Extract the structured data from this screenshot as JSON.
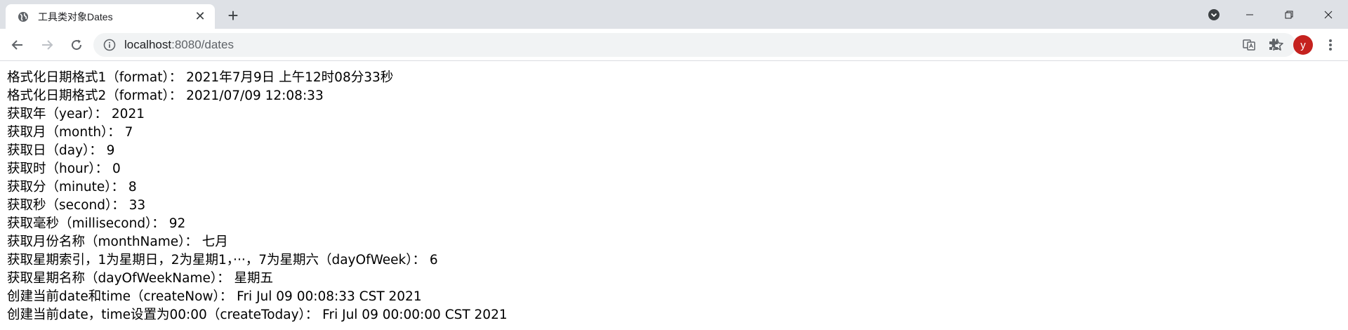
{
  "browser": {
    "tab_title": "工具类对象Dates",
    "tab_close": "✕",
    "new_tab": "+",
    "url_host": "localhost",
    "url_rest": ":8080/dates",
    "profile_initial": "y"
  },
  "content": {
    "lines": [
      "格式化日期格式1（format）：  2021年7月9日 上午12时08分33秒",
      "格式化日期格式2（format）：  2021/07/09 12:08:33",
      "获取年（year）：  2021",
      "获取月（month）：  7",
      "获取日（day）：  9",
      "获取时（hour）：  0",
      "获取分（minute）：  8",
      "获取秒（second）：  33",
      "获取毫秒（millisecond）：  92",
      "获取月份名称（monthName）：  七月",
      "获取星期索引，1为星期日，2为星期1，···，7为星期六（dayOfWeek）：  6",
      "获取星期名称（dayOfWeekName）：  星期五",
      "创建当前date和time（createNow）：  Fri Jul 09 00:08:33 CST 2021",
      "创建当前date，time设置为00:00（createToday）：  Fri Jul 09 00:00:00 CST 2021"
    ]
  }
}
